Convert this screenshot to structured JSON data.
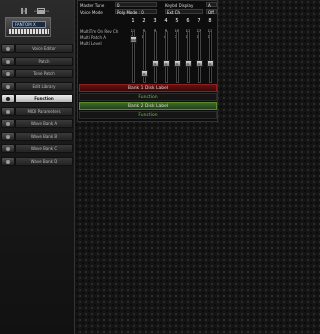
{
  "sidebar": {
    "toolbar": {
      "left_label": "add",
      "right_label": "edit mode"
    },
    "device_screen": "FANTOM X",
    "items": [
      {
        "label": "Voice Editor",
        "active": false
      },
      {
        "label": "Patch",
        "active": false
      },
      {
        "label": "Tone Patch",
        "active": false
      },
      {
        "label": "Edit Library",
        "active": false
      },
      {
        "label": "Function",
        "active": true
      },
      {
        "label": "MIDI Parameters",
        "active": false
      },
      {
        "label": "Wave Bank A",
        "active": false
      },
      {
        "label": "Wave Bank B",
        "active": false
      },
      {
        "label": "Wave Bank C",
        "active": false
      },
      {
        "label": "Wave Bank D",
        "active": false
      }
    ]
  },
  "header": {
    "master_tune_label": "Master Tune",
    "master_tune_value": "0",
    "voice_mode_label": "Voice Mode",
    "voice_mode_value": "Poly Mode : 0",
    "keybd_display_label": "Keybd Display",
    "keybd_display_value": "A",
    "ext_label": "Ext Ch",
    "ext_value": "Off"
  },
  "columns": [
    "1",
    "2",
    "3",
    "4",
    "5",
    "6",
    "7",
    "8"
  ],
  "rows": [
    {
      "label": "MultiTm On Rev Ch",
      "values": [
        "11",
        "8",
        "8",
        "8",
        "10",
        "11",
        "13",
        "11"
      ]
    },
    {
      "label": "Multi Patch A",
      "values": [
        "11",
        "12",
        "8",
        "46",
        "75",
        "15",
        "15",
        "12"
      ]
    },
    {
      "label": "Multi Level",
      "values": []
    }
  ],
  "faders": [
    {
      "level": 0.88,
      "label": "100"
    },
    {
      "level": 0.14,
      "label": "0"
    },
    {
      "level": 0.36,
      "label": "0"
    },
    {
      "level": 0.36,
      "label": "0"
    },
    {
      "level": 0.36,
      "label": "0"
    },
    {
      "level": 0.36,
      "label": "0"
    },
    {
      "level": 0.36,
      "label": "0"
    },
    {
      "level": 0.36,
      "label": "0"
    }
  ],
  "sections": [
    {
      "label": "Bank 1 Disk Label",
      "style": "red"
    },
    {
      "label": "Function",
      "style": "dark"
    },
    {
      "label": "Bank 2 Disk Label",
      "style": "green"
    },
    {
      "label": "Function",
      "style": "dark"
    }
  ]
}
